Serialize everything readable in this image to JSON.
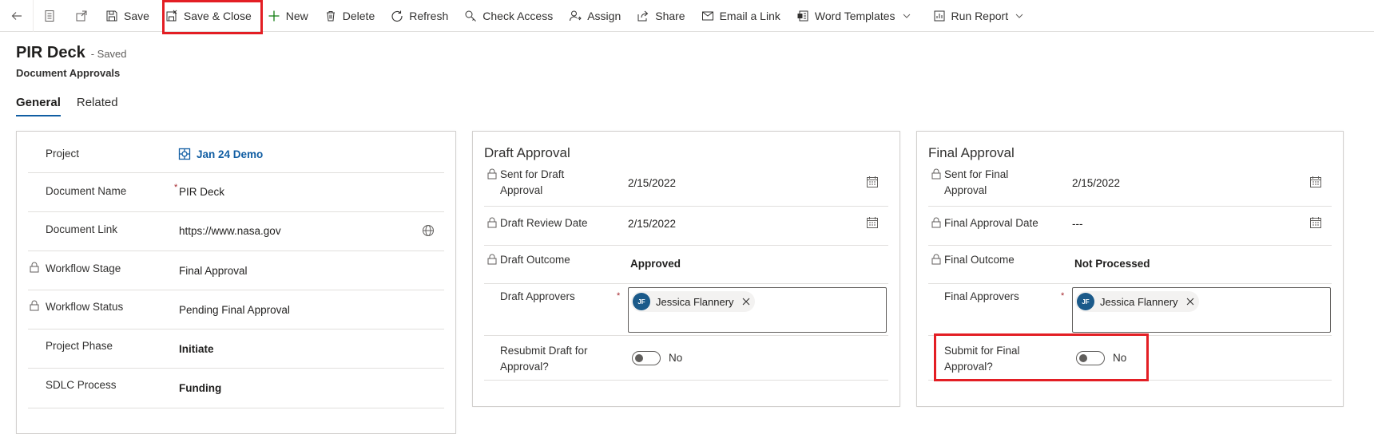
{
  "toolbar": {
    "save": "Save",
    "save_close": "Save & Close",
    "new": "New",
    "delete": "Delete",
    "refresh": "Refresh",
    "check_access": "Check Access",
    "assign": "Assign",
    "share": "Share",
    "email_link": "Email a Link",
    "word_templates": "Word Templates",
    "run_report": "Run Report"
  },
  "header": {
    "title": "PIR Deck",
    "status": "- Saved",
    "entity": "Document Approvals"
  },
  "tabs": [
    {
      "label": "General",
      "active": true
    },
    {
      "label": "Related",
      "active": false
    }
  ],
  "general": {
    "project": {
      "label": "Project",
      "value": "Jan 24 Demo"
    },
    "document_name": {
      "label": "Document Name",
      "value": "PIR Deck",
      "required_mark": "*"
    },
    "document_link": {
      "label": "Document Link",
      "value": "https://www.nasa.gov"
    },
    "workflow_stage": {
      "label": "Workflow Stage",
      "value": "Final Approval"
    },
    "workflow_status": {
      "label": "Workflow Status",
      "value": "Pending Final Approval"
    },
    "project_phase": {
      "label": "Project Phase",
      "value": "Initiate"
    },
    "sdlc_process": {
      "label": "SDLC Process",
      "value": "Funding"
    }
  },
  "draft": {
    "title": "Draft Approval",
    "sent_label_1": "Sent for Draft",
    "sent_label_2": "Approval",
    "sent_value": "2/15/2022",
    "review_label": "Draft Review Date",
    "review_value": "2/15/2022",
    "outcome_label": "Draft Outcome",
    "outcome_value": "Approved",
    "approvers_label": "Draft Approvers",
    "approvers_required": "*",
    "approver_initials": "JF",
    "approver_name": "Jessica Flannery",
    "resubmit_label_1": "Resubmit Draft for",
    "resubmit_label_2": "Approval?",
    "resubmit_value": "No"
  },
  "final": {
    "title": "Final Approval",
    "sent_label_1": "Sent for Final",
    "sent_label_2": "Approval",
    "sent_value": "2/15/2022",
    "date_label": "Final Approval Date",
    "date_value": "---",
    "outcome_label": "Final Outcome",
    "outcome_value": "Not Processed",
    "approvers_label": "Final Approvers",
    "approvers_required": "*",
    "approver_initials": "JF",
    "approver_name": "Jessica Flannery",
    "submit_label_1": "Submit for Final",
    "submit_label_2": "Approval?",
    "submit_value": "No"
  },
  "colors": {
    "accent": "#115ea3",
    "highlight": "#e31e24",
    "avatar": "#1b5a8a",
    "required": "#a4262c"
  }
}
